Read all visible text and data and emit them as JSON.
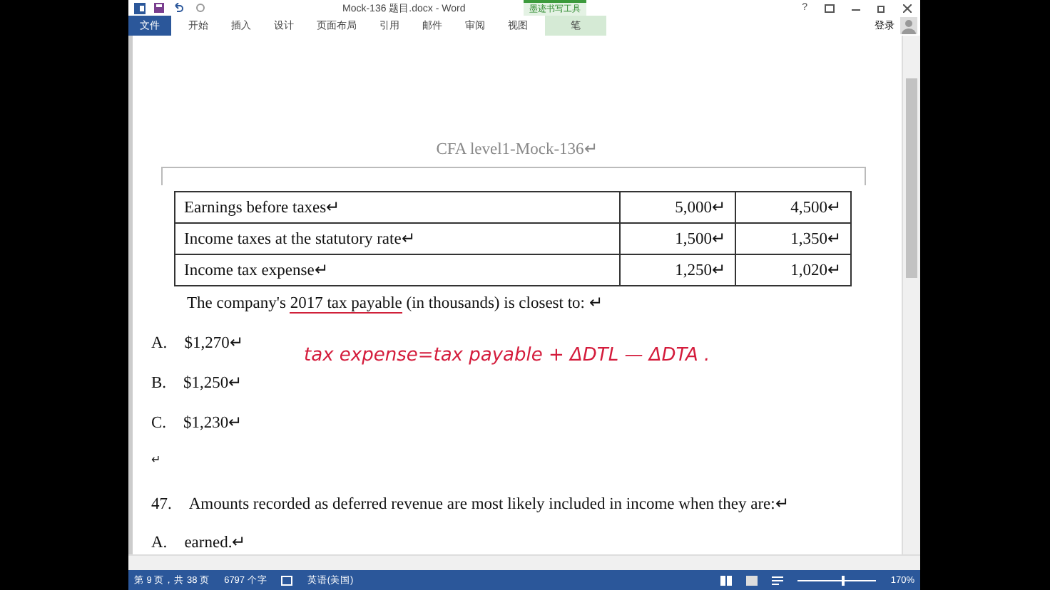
{
  "window": {
    "title": "Mock-136 题目.docx - Word",
    "help": "?",
    "sign_in": "登录"
  },
  "ribbon": {
    "tabs": [
      {
        "label": "文件",
        "kind": "file",
        "selected": false
      },
      {
        "label": "开始",
        "kind": "tab",
        "selected": false
      },
      {
        "label": "插入",
        "kind": "tab",
        "selected": false
      },
      {
        "label": "设计",
        "kind": "tab",
        "selected": false
      },
      {
        "label": "页面布局",
        "kind": "tab",
        "selected": false
      },
      {
        "label": "引用",
        "kind": "tab",
        "selected": false
      },
      {
        "label": "邮件",
        "kind": "tab",
        "selected": false
      },
      {
        "label": "审阅",
        "kind": "tab",
        "selected": false
      },
      {
        "label": "视图",
        "kind": "tab",
        "selected": false
      },
      {
        "label": "笔",
        "kind": "context",
        "selected": true
      }
    ],
    "context_group": "墨迹书写工具"
  },
  "document": {
    "header": "CFA level1-Mock-136↵",
    "table": {
      "rows": [
        [
          "Earnings before taxes↵",
          "5,000↵",
          "4,500↵"
        ],
        [
          "Income taxes at the statutory rate↵",
          "1,500↵",
          "1,350↵"
        ],
        [
          "Income tax expense↵",
          "1,250↵",
          "1,020↵"
        ]
      ]
    },
    "question": "The company's 2017 tax payable (in thousands) is closest to: ↵",
    "options": [
      {
        "letter": "A.",
        "text": "$1,270↵"
      },
      {
        "letter": "B.",
        "text": "$1,250↵"
      },
      {
        "letter": "C.",
        "text": "$1,230↵"
      }
    ],
    "ink_annotation": "tax expense=tax payable  +  ΔDTL  —  ΔDTA .",
    "blank": "↵",
    "question_47": {
      "number": "47.",
      "text": "Amounts recorded as deferred revenue are most likely included in income when they are:↵"
    },
    "option_47": {
      "letter": "A.",
      "text": "earned.↵"
    }
  },
  "status_bar": {
    "page": "第 9 页，共 38 页",
    "words": "6797 个字",
    "language": "英语(美国)",
    "zoom": "170%",
    "zoom_slider": {
      "level": 0.55
    }
  }
}
